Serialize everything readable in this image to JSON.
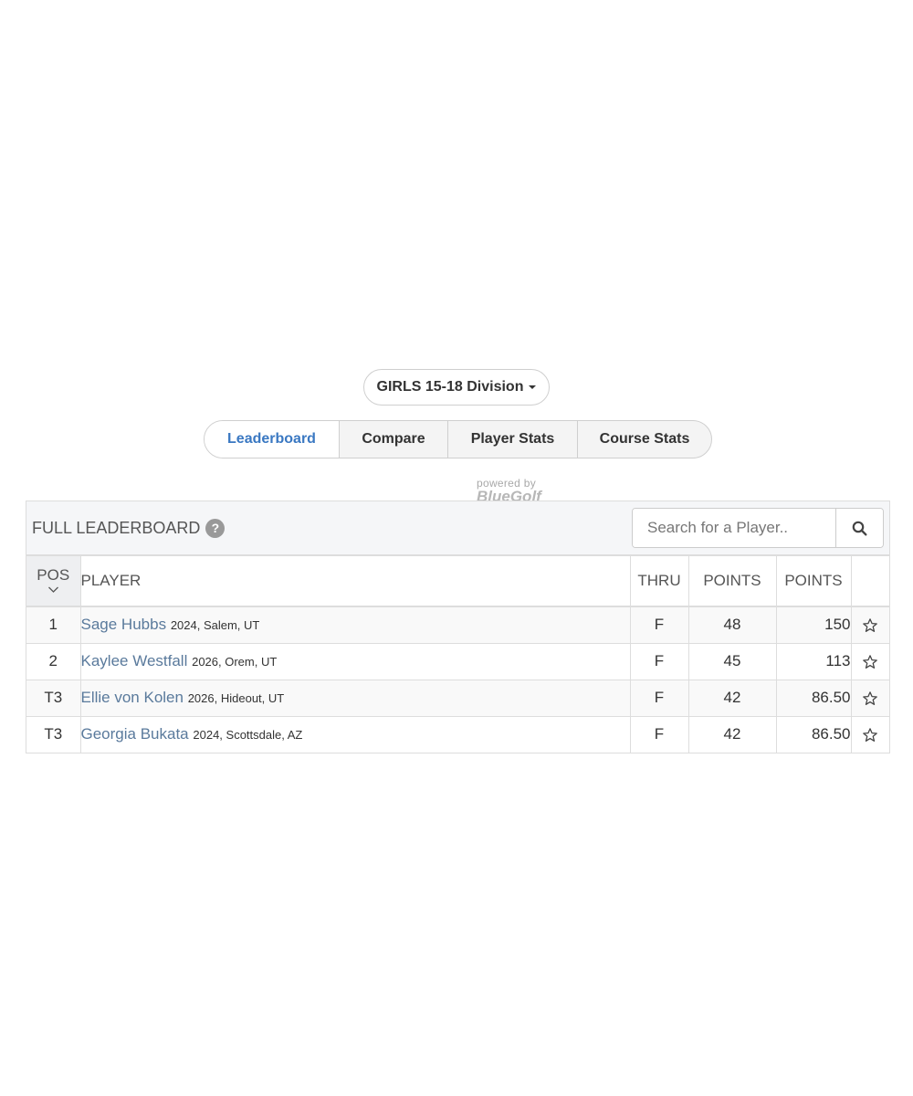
{
  "division": {
    "label": "GIRLS 15-18 Division"
  },
  "tabs": [
    {
      "label": "Leaderboard",
      "active": true
    },
    {
      "label": "Compare",
      "active": false
    },
    {
      "label": "Player Stats",
      "active": false
    },
    {
      "label": "Course Stats",
      "active": false
    }
  ],
  "powered": {
    "text": "powered by",
    "brand": "BlueGolf"
  },
  "leaderboard": {
    "title": "FULL LEADERBOARD",
    "help_icon": "question-circle-icon",
    "search": {
      "placeholder": "Search for a Player..",
      "value": "",
      "icon": "search-icon"
    },
    "columns": [
      "POS",
      "PLAYER",
      "THRU",
      "POINTS",
      "POINTS"
    ],
    "rows": [
      {
        "pos": "1",
        "name": "Sage Hubbs",
        "info": "2024, Salem, UT",
        "thru": "F",
        "points": "48",
        "total": "150"
      },
      {
        "pos": "2",
        "name": "Kaylee Westfall",
        "info": "2026, Orem, UT",
        "thru": "F",
        "points": "45",
        "total": "113"
      },
      {
        "pos": "T3",
        "name": "Ellie von Kolen",
        "info": "2026, Hideout, UT",
        "thru": "F",
        "points": "42",
        "total": "86.50"
      },
      {
        "pos": "T3",
        "name": "Georgia Bukata",
        "info": "2024, Scottsdale, AZ",
        "thru": "F",
        "points": "42",
        "total": "86.50"
      }
    ]
  },
  "colors": {
    "accent": "#3a78c2",
    "player_link": "#5a7a9c",
    "border": "#dddddd",
    "header_bg": "#f5f6f8"
  }
}
